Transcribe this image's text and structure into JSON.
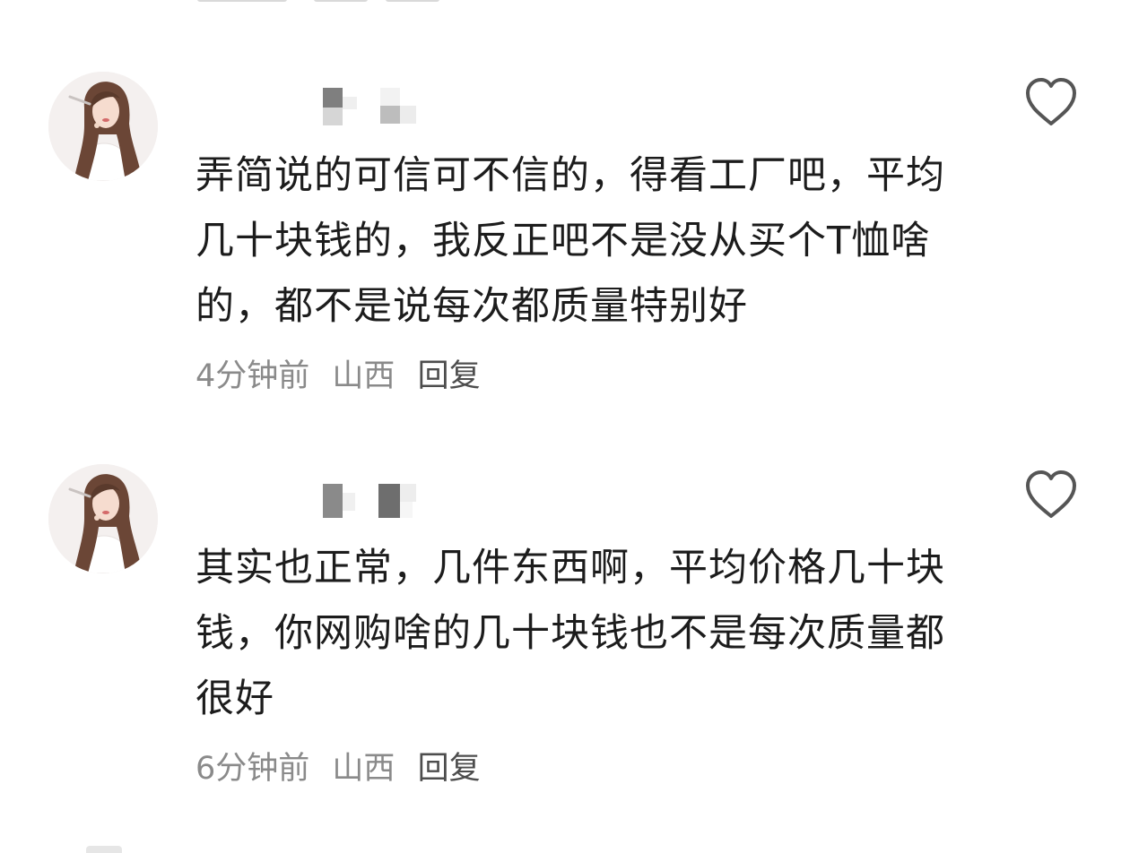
{
  "comments": [
    {
      "username": "",
      "text": "弄简说的可信可不信的，得看工厂吧，平均几十块钱的，我反正吧不是没从买个T恤啥的，都不是说每次都质量特别好",
      "time": "4分钟前",
      "location": "山西",
      "reply_label": "回复",
      "like_icon": "heart-outline-icon"
    },
    {
      "username": "",
      "text": "其实也正常，几件东西啊，平均价格几十块钱，你网购啥的几十块钱也不是每次质量都很好",
      "time": "6分钟前",
      "location": "山西",
      "reply_label": "回复",
      "like_icon": "heart-outline-icon"
    }
  ],
  "colors": {
    "background": "#ffffff",
    "text": "#1c1c1c",
    "meta": "#8a8a8a",
    "reply": "#4d4d4d",
    "icon": "#555555"
  }
}
